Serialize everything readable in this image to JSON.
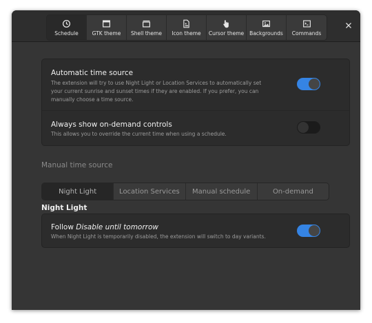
{
  "header": {
    "tabs": [
      {
        "label": "Schedule",
        "icon": "clock-icon",
        "active": true
      },
      {
        "label": "GTK theme",
        "icon": "window-icon",
        "active": false
      },
      {
        "label": "Shell theme",
        "icon": "shell-window-icon",
        "active": false
      },
      {
        "label": "Icon theme",
        "icon": "file-image-icon",
        "active": false
      },
      {
        "label": "Cursor theme",
        "icon": "pointer-hand-icon",
        "active": false
      },
      {
        "label": "Backgrounds",
        "icon": "picture-icon",
        "active": false
      },
      {
        "label": "Commands",
        "icon": "terminal-icon",
        "active": false
      }
    ],
    "close_icon": "close-icon"
  },
  "settings_card": {
    "auto_source": {
      "title": "Automatic time source",
      "description": "The extension will try to use Night Light or Location Services to automatically set your current sunrise and sunset times if they are enabled. If you prefer, you can manually choose a time source.",
      "enabled": true
    },
    "on_demand": {
      "title": "Always show on-demand controls",
      "description": "This allows you to override the current time when using a schedule.",
      "enabled": false
    }
  },
  "manual_source": {
    "title": "Manual time source",
    "options": [
      "Night Light",
      "Location Services",
      "Manual schedule",
      "On-demand"
    ],
    "selected": "Night Light"
  },
  "night_light": {
    "title": "Night Light",
    "follow_prefix": "Follow ",
    "follow_emph": "Disable until tomorrow",
    "description": "When Night Light is temporarily disabled, the extension will switch to day variants.",
    "enabled": true
  },
  "colors": {
    "accent": "#3584e4",
    "window_bg": "#353535",
    "card_bg": "#2c2c2c"
  }
}
